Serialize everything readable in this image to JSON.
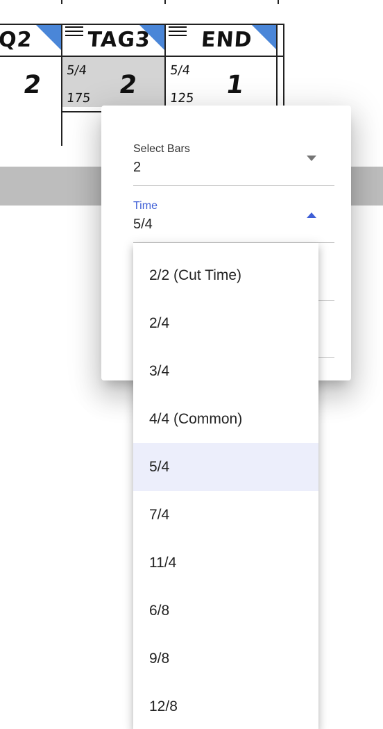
{
  "chart": {
    "headers": [
      {
        "label": "Q2"
      },
      {
        "label": "TAG3"
      },
      {
        "label": "END"
      }
    ],
    "cells": [
      {
        "bars": "2"
      },
      {
        "time": "5/4",
        "tempo": "175",
        "bars": "2"
      },
      {
        "time": "5/4",
        "tempo": "125",
        "bars": "1"
      }
    ]
  },
  "dialog": {
    "select_bars": {
      "label": "Select Bars",
      "value": "2"
    },
    "time": {
      "label": "Time",
      "value": "5/4"
    }
  },
  "time_menu": {
    "options": [
      "2/2 (Cut Time)",
      "2/4",
      "3/4",
      "4/4 (Common)",
      "5/4",
      "7/4",
      "11/4",
      "6/8",
      "9/8",
      "12/8"
    ],
    "selected": "5/4"
  },
  "colors": {
    "accent": "#3f5fd6",
    "corner_marker": "#4a86d8",
    "selected_option_bg": "#eceefb",
    "band": "#bdbdbd"
  }
}
